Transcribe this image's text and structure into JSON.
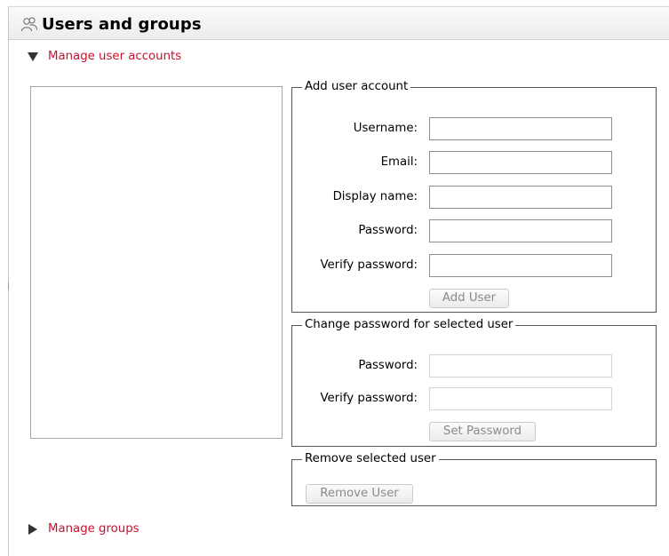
{
  "header": {
    "title": "Users and groups",
    "icon": "users-icon"
  },
  "sections": {
    "manage_users": {
      "label": "Manage user accounts",
      "expanded": true,
      "icon": "triangle-down-icon"
    },
    "manage_groups": {
      "label": "Manage groups",
      "expanded": false,
      "icon": "triangle-right-icon"
    }
  },
  "user_list": {
    "items": []
  },
  "add_user": {
    "legend": "Add user account",
    "fields": [
      {
        "label": "Username:",
        "value": ""
      },
      {
        "label": "Email:",
        "value": ""
      },
      {
        "label": "Display name:",
        "value": ""
      },
      {
        "label": "Password:",
        "value": ""
      },
      {
        "label": "Verify password:",
        "value": ""
      }
    ],
    "button": "Add User"
  },
  "change_password": {
    "legend": "Change password for selected user",
    "fields": [
      {
        "label": "Password:",
        "value": ""
      },
      {
        "label": "Verify password:",
        "value": ""
      }
    ],
    "button": "Set Password"
  },
  "remove_user": {
    "legend": "Remove selected user",
    "button": "Remove User"
  },
  "colors": {
    "link": "#c8102e",
    "border": "#555555",
    "disabled_text": "#8a8a8a"
  }
}
